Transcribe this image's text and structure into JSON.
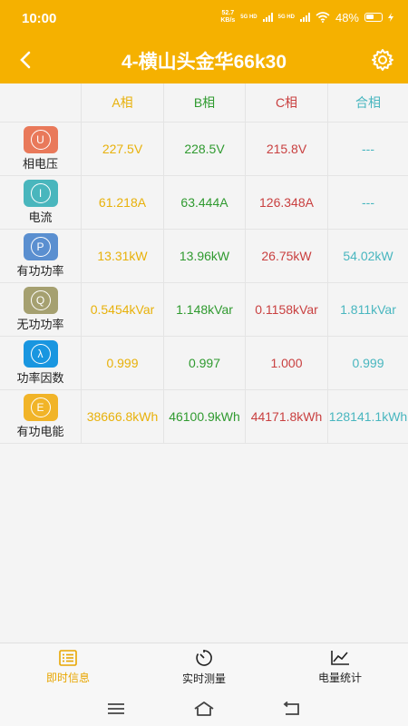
{
  "status": {
    "time": "10:00",
    "net_speed": "52.7",
    "net_unit": "KB/s",
    "sim1": "5G HD",
    "sim2": "5G HD",
    "battery": "48%"
  },
  "appbar": {
    "title": "4-横山头金华66k30"
  },
  "table": {
    "headers": [
      "A相",
      "B相",
      "C相",
      "合相"
    ],
    "rows": [
      {
        "icon_letter": "U",
        "icon_color": "#e9795a",
        "label": "相电压",
        "a": "227.5V",
        "b": "228.5V",
        "c": "215.8V",
        "t": "---"
      },
      {
        "icon_letter": "I",
        "icon_color": "#49b6bd",
        "label": "电流",
        "a": "61.218A",
        "b": "63.444A",
        "c": "126.348A",
        "t": "---"
      },
      {
        "icon_letter": "P",
        "icon_color": "#5a8fd0",
        "label": "有功功率",
        "a": "13.31kW",
        "b": "13.96kW",
        "c": "26.75kW",
        "t": "54.02kW"
      },
      {
        "icon_letter": "Q",
        "icon_color": "#a5a070",
        "label": "无功功率",
        "a": "0.5454kVar",
        "b": "1.148kVar",
        "c": "0.1158kVar",
        "t": "1.811kVar"
      },
      {
        "icon_letter": "λ",
        "icon_color": "#1996e0",
        "label": "功率因数",
        "a": "0.999",
        "b": "0.997",
        "c": "1.000",
        "t": "0.999"
      },
      {
        "icon_letter": "E",
        "icon_color": "#f1b428",
        "label": "有功电能",
        "a": "38666.8kWh",
        "b": "46100.9kWh",
        "c": "44171.8kWh",
        "t": "128141.1kWh"
      }
    ]
  },
  "tabs": [
    {
      "label": "即时信息",
      "icon": "list-icon",
      "active": true
    },
    {
      "label": "实时测量",
      "icon": "timer-icon",
      "active": false
    },
    {
      "label": "电量统计",
      "icon": "chart-icon",
      "active": false
    }
  ],
  "colors": {
    "accent": "#f5b100",
    "phaseA": "#e8b10a",
    "phaseB": "#2f9a2f",
    "phaseC": "#c94040",
    "total": "#48b6bf"
  }
}
